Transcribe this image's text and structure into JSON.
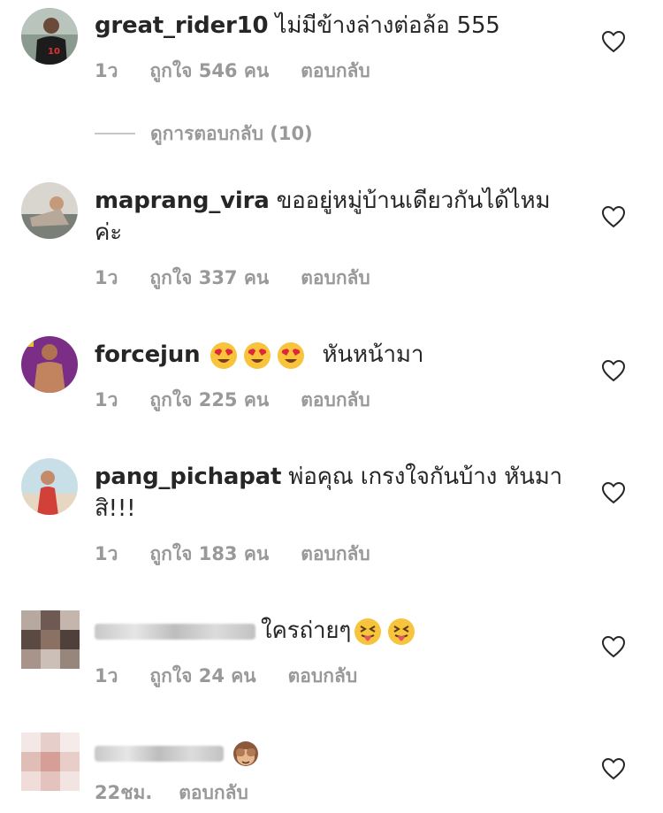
{
  "comments": [
    {
      "username": "great_rider10",
      "text": "ไม่มีข้างล่างต่อล้อ 555",
      "time": "1ว",
      "likes": "ถูกใจ 546 คน",
      "reply": "ตอบกลับ"
    },
    {
      "username": "maprang_vira",
      "text": "ขออยู่หมู่บ้านเดียวกันได้ไหม ค่ะ",
      "time": "1ว",
      "likes": "ถูกใจ 337 คน",
      "reply": "ตอบกลับ"
    },
    {
      "username": "forcejun",
      "text": "หันหน้ามา",
      "time": "1ว",
      "likes": "ถูกใจ 225 คน",
      "reply": "ตอบกลับ"
    },
    {
      "username": "pang_pichapat",
      "text": "พ่อคุณ เกรงใจกันบ้าง หันมา สิ!!!",
      "time": "1ว",
      "likes": "ถูกใจ 183 คน",
      "reply": "ตอบกลับ"
    },
    {
      "username": "",
      "text": "ใครถ่ายๆ",
      "time": "1ว",
      "likes": "ถูกใจ 24 คน",
      "reply": "ตอบกลับ"
    },
    {
      "username": "",
      "text": "",
      "time": "22ชม.",
      "likes": "",
      "reply": "ตอบกลับ"
    }
  ],
  "view_replies": "ดูการตอบกลับ (10)",
  "icons": {
    "like": "heart-outline-icon",
    "emoji_love": "heart-eyes-emoji",
    "emoji_tongue": "squinting-tongue-emoji",
    "emoji_monkey": "see-no-evil-monkey-emoji"
  },
  "colors": {
    "text": "#262626",
    "meta": "#999999",
    "heart_stroke": "#262626"
  }
}
